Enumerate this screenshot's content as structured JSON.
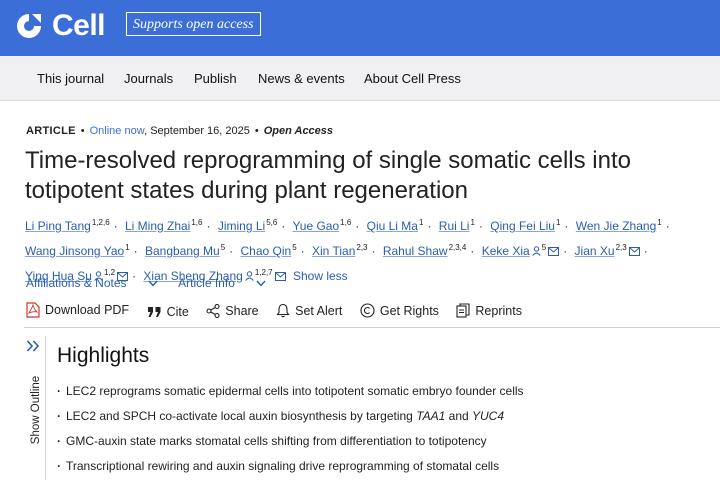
{
  "brand": {
    "name": "Cell",
    "badge": "Supports open access"
  },
  "nav": [
    "This journal",
    "Journals",
    "Publish",
    "News & events",
    "About Cell Press"
  ],
  "article": {
    "type": "ARTICLE",
    "status": "Online now",
    "date": "September 16, 2025",
    "access": "Open Access",
    "title_line1": "Time-resolved reprogramming of single somatic cells into",
    "title_line2": "totipotent states during plant regeneration"
  },
  "authors": [
    {
      "name": "Li Ping Tang",
      "aff": "1,2,6"
    },
    {
      "name": "Li Ming Zhai",
      "aff": "1,6"
    },
    {
      "name": "Jiming Li",
      "aff": "5,6"
    },
    {
      "name": "Yue Gao",
      "aff": "1,6"
    },
    {
      "name": "Qiu Li Ma",
      "aff": "1"
    },
    {
      "name": "Rui Li",
      "aff": "1"
    },
    {
      "name": "Qing Fei Liu",
      "aff": "1"
    },
    {
      "name": "Wen Jie Zhang",
      "aff": "1"
    },
    {
      "name": "Wang Jinsong Yao",
      "aff": "1"
    },
    {
      "name": "Bangbang Mu",
      "aff": "5"
    },
    {
      "name": "Chao Qin",
      "aff": "5"
    },
    {
      "name": "Xin Tian",
      "aff": "2,3"
    },
    {
      "name": "Rahul Shaw",
      "aff": "2,3,4"
    },
    {
      "name": "Keke Xia",
      "aff": "5"
    },
    {
      "name": "Jian Xu",
      "aff": "2,3"
    },
    {
      "name": "Ying Hua Su",
      "aff": "1,2"
    },
    {
      "name": "Xian Sheng Zhang",
      "aff": "1,2,7"
    }
  ],
  "show_less": "Show less",
  "aff_notes": {
    "affiliations": "Affiliations & Notes",
    "article_info": "Article Info"
  },
  "toolbar": {
    "download": "Download PDF",
    "cite": "Cite",
    "share": "Share",
    "alert": "Set Alert",
    "rights": "Get Rights",
    "reprints": "Reprints"
  },
  "outline": {
    "label": "Show Outline"
  },
  "highlights": {
    "title": "Highlights",
    "item1": "LEC2 reprograms somatic epidermal cells into totipotent somatic embryo founder cells",
    "item2_a": "LEC2 and SPCH co-activate local auxin biosynthesis by targeting ",
    "item2_b": "TAA1",
    "item2_c": " and ",
    "item2_d": "YUC4",
    "item3": "GMC-auxin state marks stomatal cells shifting from differentiation to totipotency",
    "item4": "Transcriptional rewiring and auxin signaling drive reprogramming of stomatal cells"
  },
  "colors": {
    "brand_blue": "#3c6ed8",
    "link_blue": "#2a5db0",
    "pdf_red": "#d0342c"
  }
}
